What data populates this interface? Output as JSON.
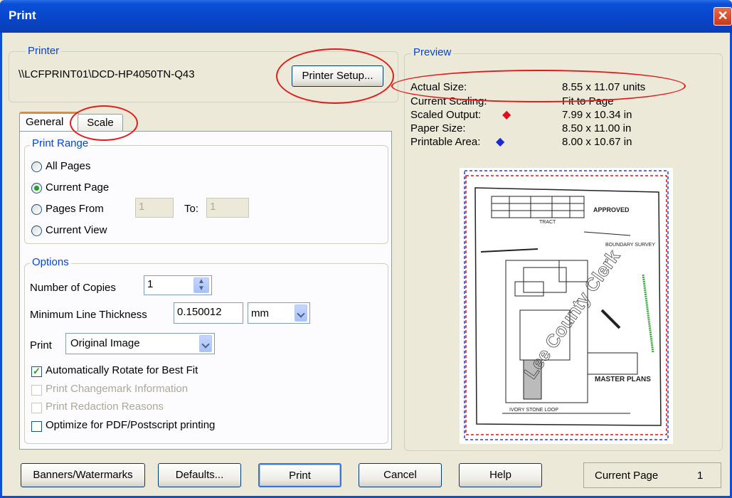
{
  "window": {
    "title": "Print",
    "close_glyph": "✕"
  },
  "printer": {
    "legend": "Printer",
    "name": "\\\\LCFPRINT01\\DCD-HP4050TN-Q43",
    "setup_button": "Printer Setup..."
  },
  "tabs": [
    {
      "label": "General",
      "active": true
    },
    {
      "label": "Scale",
      "active": false
    }
  ],
  "print_range": {
    "legend": "Print Range",
    "options": [
      "All Pages",
      "Current Page",
      "Pages From",
      "Current View"
    ],
    "selected": "Current Page",
    "from_value": "1",
    "to_label": "To:",
    "to_value": "1"
  },
  "options": {
    "legend": "Options",
    "copies_label": "Number of Copies",
    "copies_value": "1",
    "line_thickness_label": "Minimum Line Thickness",
    "line_thickness_value": "0.150012",
    "line_unit": "mm",
    "print_label": "Print",
    "print_value": "Original Image",
    "checkboxes": [
      {
        "label": "Automatically Rotate for Best Fit",
        "checked": true,
        "enabled": true
      },
      {
        "label": "Print Changemark Information",
        "checked": false,
        "enabled": false
      },
      {
        "label": "Print Redaction Reasons",
        "checked": false,
        "enabled": false
      },
      {
        "label": "Optimize for PDF/Postscript printing",
        "checked": false,
        "enabled": true
      }
    ]
  },
  "preview": {
    "legend": "Preview",
    "rows": [
      {
        "label": "Actual Size:",
        "value": "8.55 x 11.07 units"
      },
      {
        "label": "Current Scaling:",
        "value": "Fit to Page"
      },
      {
        "label": "Scaled Output:",
        "value": "7.99 x 10.34 in",
        "marker_color": "#e0101a"
      },
      {
        "label": "Paper Size:",
        "value": "8.50 x 11.00 in"
      },
      {
        "label": "Printable Area:",
        "value": "8.00 x 10.67 in",
        "marker_color": "#1a2bd0"
      }
    ],
    "thumbnail": {
      "watermark": "Lee County Clerk",
      "stamp": "APPROVED",
      "plan_title": "MASTER PLANS",
      "road_label": "IVORY STONE LOOP",
      "tract_label": "TRACT",
      "survey_label": "BOUNDARY SURVEY"
    }
  },
  "buttons": {
    "banners": "Banners/Watermarks",
    "defaults": "Defaults...",
    "print": "Print",
    "cancel": "Cancel",
    "help": "Help"
  },
  "status": {
    "label": "Current Page",
    "value": "1"
  },
  "annotation_color": "#e31b1b"
}
